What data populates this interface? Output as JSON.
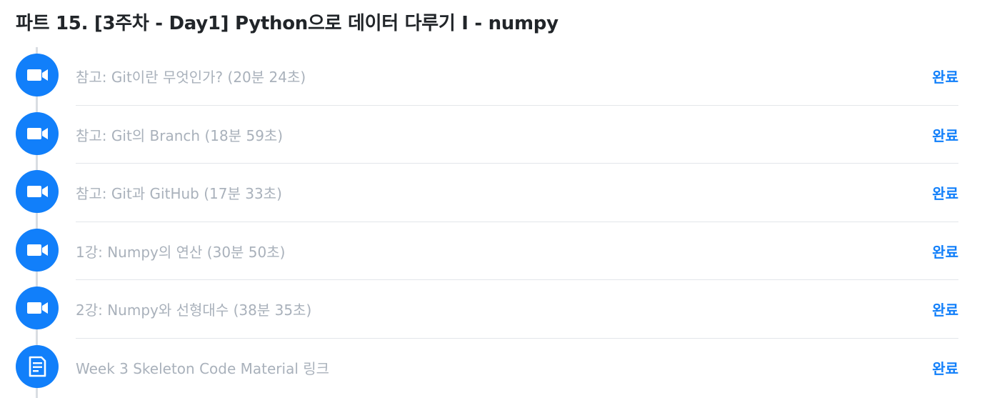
{
  "section": {
    "title": "파트 15. [3주차 - Day1] Python으로 데이터 다루기 I - numpy"
  },
  "colors": {
    "accent": "#117ffa",
    "lesson_text": "#a9b1bb",
    "title_text": "#212529",
    "timeline": "#d9dde2",
    "divider": "#e3e6ea"
  },
  "lessons": [
    {
      "icon": "video-camera-icon",
      "title": "참고: Git이란 무엇인가? (20분 24초)",
      "status": "완료"
    },
    {
      "icon": "video-camera-icon",
      "title": "참고: Git의 Branch (18분 59초)",
      "status": "완료"
    },
    {
      "icon": "video-camera-icon",
      "title": "참고: Git과 GitHub (17분 33초)",
      "status": "완료"
    },
    {
      "icon": "video-camera-icon",
      "title": "1강: Numpy의 연산 (30분 50초)",
      "status": "완료"
    },
    {
      "icon": "video-camera-icon",
      "title": "2강: Numpy와 선형대수 (38분 35초)",
      "status": "완료"
    },
    {
      "icon": "document-icon",
      "title": "Week 3 Skeleton Code Material 링크",
      "status": "완료"
    }
  ]
}
